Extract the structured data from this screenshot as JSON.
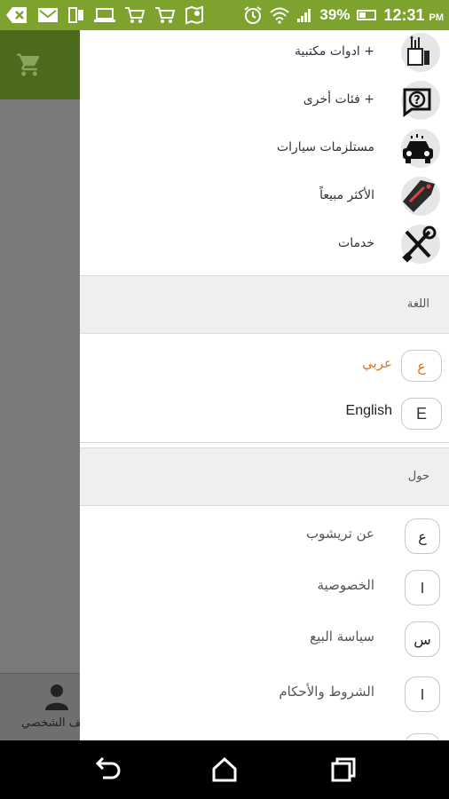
{
  "status_bar": {
    "signal_text": "39%",
    "time": "12:31",
    "ampm": "PM",
    "icons": [
      "back-arrow-icon",
      "mail-icon",
      "phone-icon",
      "laptop-icon",
      "cart-icon",
      "cart-icon",
      "maps-icon",
      "alarm-icon",
      "wifi-icon",
      "signal-icon",
      "battery-icon"
    ]
  },
  "background_app": {
    "cart_icon": "shopping-cart-icon",
    "profile_label": "لف الشخصي",
    "profile_icon": "person-icon"
  },
  "drawer": {
    "categories": [
      {
        "label": "+ ادوات مكتبية",
        "icon": "stationery-icon"
      },
      {
        "label": "+ فئات أخرى",
        "icon": "question-bubble-icon"
      },
      {
        "label": "مستلزمات سيارات",
        "icon": "car-icon"
      },
      {
        "label": "الأكثر مبيعاً",
        "icon": "price-tag-icon"
      },
      {
        "label": "خدمات",
        "icon": "tools-icon"
      }
    ],
    "language_section": {
      "title": "اللغة",
      "options": [
        {
          "letter": "ع",
          "label": "عربي",
          "active": true
        },
        {
          "letter": "E",
          "label": "English",
          "active": false
        }
      ]
    },
    "about_section": {
      "title": "حول",
      "items": [
        {
          "letter": "ع",
          "label": "عن تريشوب"
        },
        {
          "letter": "ا",
          "label": "الخصوصية"
        },
        {
          "letter": "س",
          "label": "سياسة البيع"
        },
        {
          "letter": "ا",
          "label": "الشروط والأحكام"
        }
      ]
    },
    "accent_color": "#e0761c"
  },
  "nav_bar": {
    "back": "back-icon",
    "home": "home-icon",
    "recents": "recents-icon"
  },
  "colors": {
    "status_bar": "#7da32e",
    "toolbar": "#4b6a1c",
    "accent": "#e0761c"
  }
}
